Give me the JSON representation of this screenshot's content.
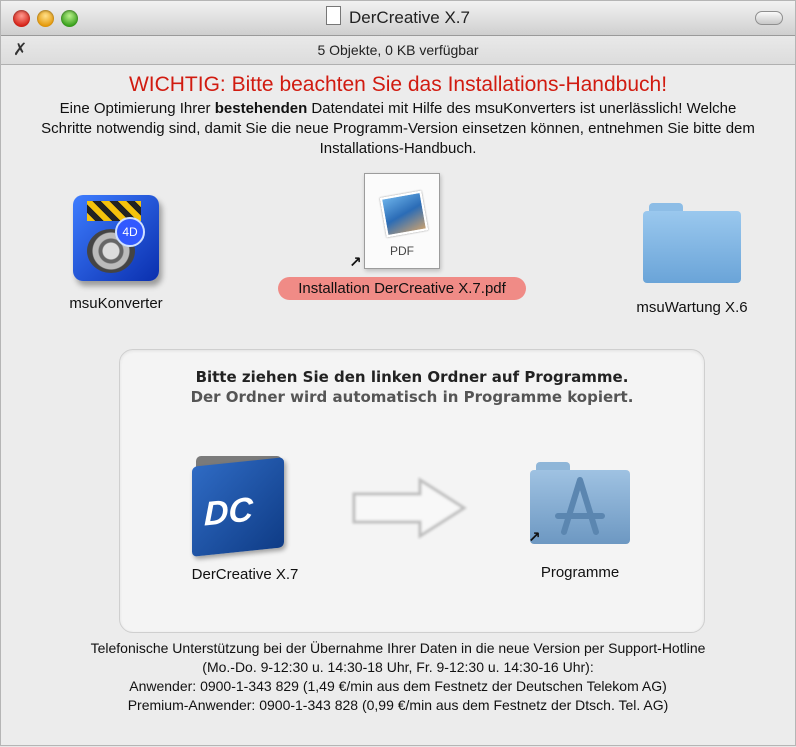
{
  "window": {
    "title": "DerCreative X.7",
    "status": "5 Objekte, 0 KB verfügbar"
  },
  "notice": {
    "warning": "WICHTIG: Bitte beachten Sie das Installations-Handbuch!",
    "intro_part1": "Eine Optimierung Ihrer ",
    "intro_bold": "bestehenden",
    "intro_part2": " Datendatei mit Hilfe des msuKonverters ist unerlässlich! Welche Schritte notwendig sind, damit Sie die neue Programm-Version einsetzen können, entnehmen Sie bitte dem Installations-Handbuch."
  },
  "icons": {
    "konverter": "msuKonverter",
    "pdf_label": "Installation DerCreative X.7.pdf",
    "pdf_badge": "PDF",
    "wartung": "msuWartung X.6"
  },
  "install": {
    "title": "Bitte ziehen Sie den linken Ordner auf Programme.",
    "subtitle": "Der Ordner wird automatisch in Programme kopiert.",
    "app_label": "DerCreative X.7",
    "app_badge": "DC",
    "target_label": "Programme"
  },
  "support": {
    "line1": "Telefonische Unterstützung bei der Übernahme Ihrer Daten in die neue Version per Support-Hotline",
    "line2": "(Mo.-Do. 9-12:30 u. 14:30-18 Uhr, Fr. 9-12:30 u. 14:30-16 Uhr):",
    "line3": "Anwender: 0900-1-343 829 (1,49 €/min aus dem Festnetz der Deutschen Telekom AG)",
    "line4": "Premium-Anwender: 0900-1-343 828 (0,99 €/min aus dem Festnetz der Dtsch. Tel. AG)"
  },
  "colors": {
    "warning": "#d11b10",
    "selection": "#f08b86",
    "folder_blue": "#7fb2e0"
  }
}
